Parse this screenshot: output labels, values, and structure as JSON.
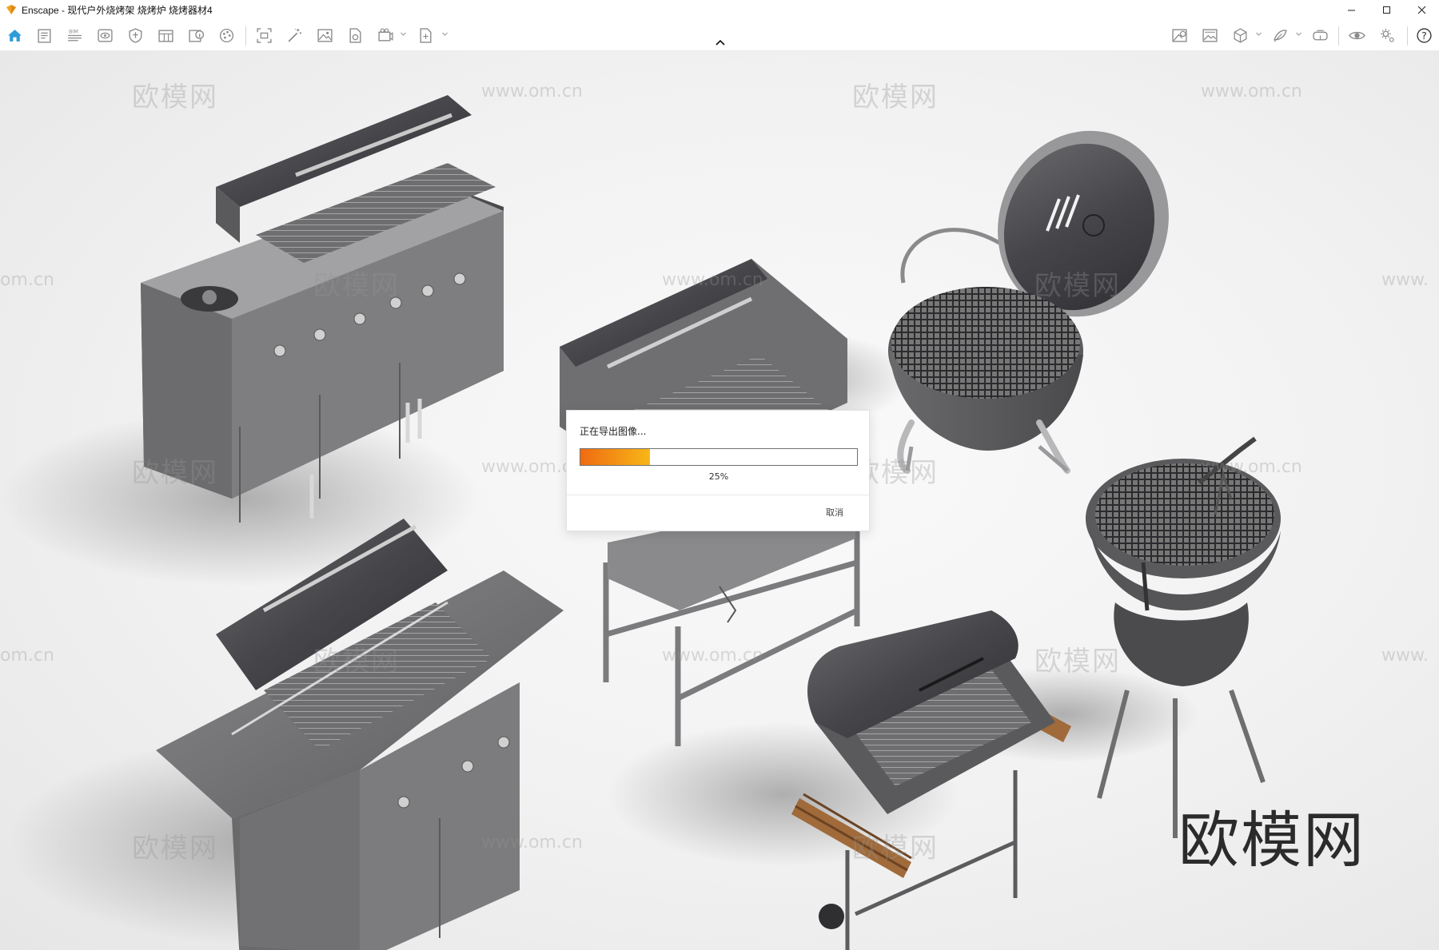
{
  "window": {
    "app_name": "Enscape",
    "separator": "-",
    "document_title": "现代户外烧烤架 烧烤炉 烧烤器材4",
    "controls": [
      "minimize-icon",
      "maximize-icon",
      "close-icon"
    ]
  },
  "toolbar": {
    "left_icons": [
      "home-icon",
      "sheet-icon",
      "bim-icon",
      "views-icon",
      "shield-icon",
      "layout-icon",
      "info-icon",
      "palette-icon",
      "capture-icon",
      "magic-wand-icon",
      "image-icon",
      "export-file-icon",
      "render-video-icon",
      "export-menu-icon"
    ],
    "right_icons": [
      "asset-library-icon",
      "panorama-icon",
      "material-cube-icon",
      "material-editor-icon",
      "vr-headset-icon",
      "visibility-eye-icon",
      "settings-gear-icon",
      "help-icon"
    ],
    "accent_color": "#2f9bd8"
  },
  "viewport": {
    "watermark_cn": "欧模网",
    "watermark_url": "www.om.cn",
    "watermark_partial_left": "om.cn",
    "watermark_partial_right": "www.",
    "brand_logo": "欧模网"
  },
  "export_dialog": {
    "title": "正在导出图像...",
    "progress_percent": 25,
    "progress_label": "25%",
    "cancel_label": "取消",
    "bar_colors": [
      "#ef6b12",
      "#f8b717"
    ]
  }
}
